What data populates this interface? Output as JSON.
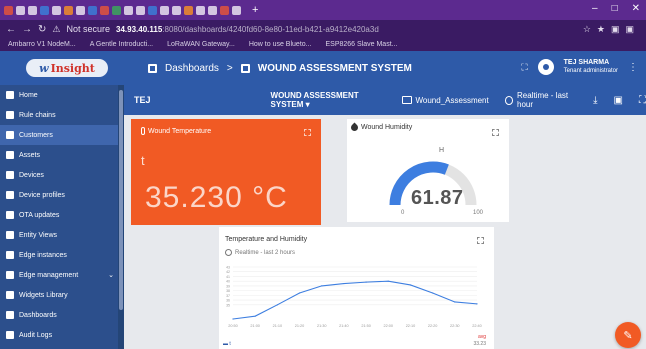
{
  "browser": {
    "address_host": "34.93.40.115",
    "address_rest": ":8080/dashboards/4240fd60-8e80-11ed-b421-a9412e420a3d",
    "not_secure": "Not secure",
    "bookmarks": [
      "Ambarro V1 NodeM...",
      "A Gentle Introducti...",
      "LoRaWAN Gateway...",
      "How to use Blueto...",
      "ESP8266 Slave Mast..."
    ]
  },
  "app": {
    "logo_w": "w",
    "logo_text": "Insight",
    "breadcrumb_root": "Dashboards",
    "breadcrumb_sep": ">",
    "breadcrumb_current": "WOUND ASSESSMENT SYSTEM",
    "user_name": "TEJ SHARMA",
    "user_role": "Tenant administrator"
  },
  "sidebar": {
    "items": [
      {
        "label": "Home"
      },
      {
        "label": "Rule chains"
      },
      {
        "label": "Customers"
      },
      {
        "label": "Assets"
      },
      {
        "label": "Devices"
      },
      {
        "label": "Device profiles"
      },
      {
        "label": "OTA updates"
      },
      {
        "label": "Entity Views"
      },
      {
        "label": "Edge instances"
      },
      {
        "label": "Edge management"
      },
      {
        "label": "Widgets Library"
      },
      {
        "label": "Dashboards"
      },
      {
        "label": "Audit Logs"
      }
    ]
  },
  "toolbar": {
    "title": "TEJ",
    "dashboard_select": "WOUND ASSESSMENT SYSTEM ▾",
    "state": "Wound_Assessment",
    "time_window": "Realtime - last hour"
  },
  "temperature": {
    "title": "Wound Temperature",
    "label": "t",
    "value": "35.230 °C"
  },
  "humidity": {
    "title": "Wound Humidity",
    "unit_label": "H",
    "value": "61.87",
    "min": "0",
    "max": "100",
    "level": 0.6187,
    "color": "#3d7ee0"
  },
  "chart": {
    "title": "Temperature and Humidity",
    "subtitle": "Realtime - last 2 hours",
    "legend": "t",
    "unit": "avg",
    "last": "33.23"
  },
  "chart_data": {
    "type": "line",
    "title": "Temperature and Humidity",
    "x": [
      "20:50",
      "21:00",
      "21:10",
      "21:20",
      "21:30",
      "21:40",
      "21:50",
      "22:00",
      "22:10",
      "22:20",
      "22:30",
      "22:40"
    ],
    "series": [
      {
        "name": "t",
        "values": [
          32,
          32.6,
          35,
          37.5,
          39,
          39.5,
          39.8,
          40,
          39.2,
          37.5,
          35.6,
          35.2
        ]
      }
    ],
    "y_ticks": [
      "35",
      "36",
      "37",
      "38",
      "39",
      "40",
      "41",
      "42",
      "43"
    ],
    "ylim": [
      32,
      43
    ],
    "grid": true,
    "color": "#3d7ee0"
  }
}
